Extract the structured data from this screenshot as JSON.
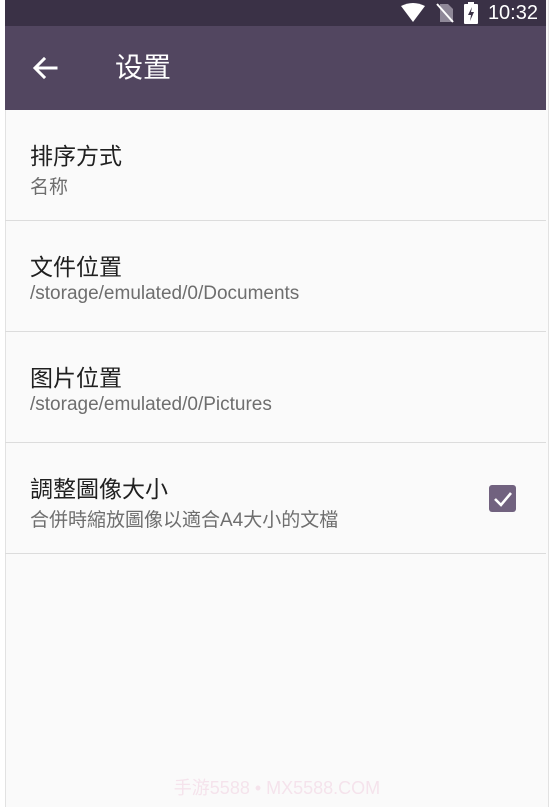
{
  "status_bar": {
    "time": "10:32",
    "icons": [
      "wifi-icon",
      "no-sim-icon",
      "battery-charging-icon"
    ]
  },
  "app_bar": {
    "back_icon": "arrow-left-icon",
    "title": "设置"
  },
  "preferences": [
    {
      "title": "排序方式",
      "summary": "名称"
    },
    {
      "title": "文件位置",
      "summary": "/storage/emulated/0/Documents"
    },
    {
      "title": "图片位置",
      "summary": "/storage/emulated/0/Pictures"
    },
    {
      "title": "調整圖像大小",
      "summary": "合併時縮放圖像以適合A4大小的文檔",
      "checked": true
    }
  ],
  "watermark": "手游5588 • MX5588.COM",
  "colors": {
    "status_bar": "#3a3146",
    "app_bar": "#524660",
    "accent": "#71627f",
    "background": "#fafafa"
  }
}
